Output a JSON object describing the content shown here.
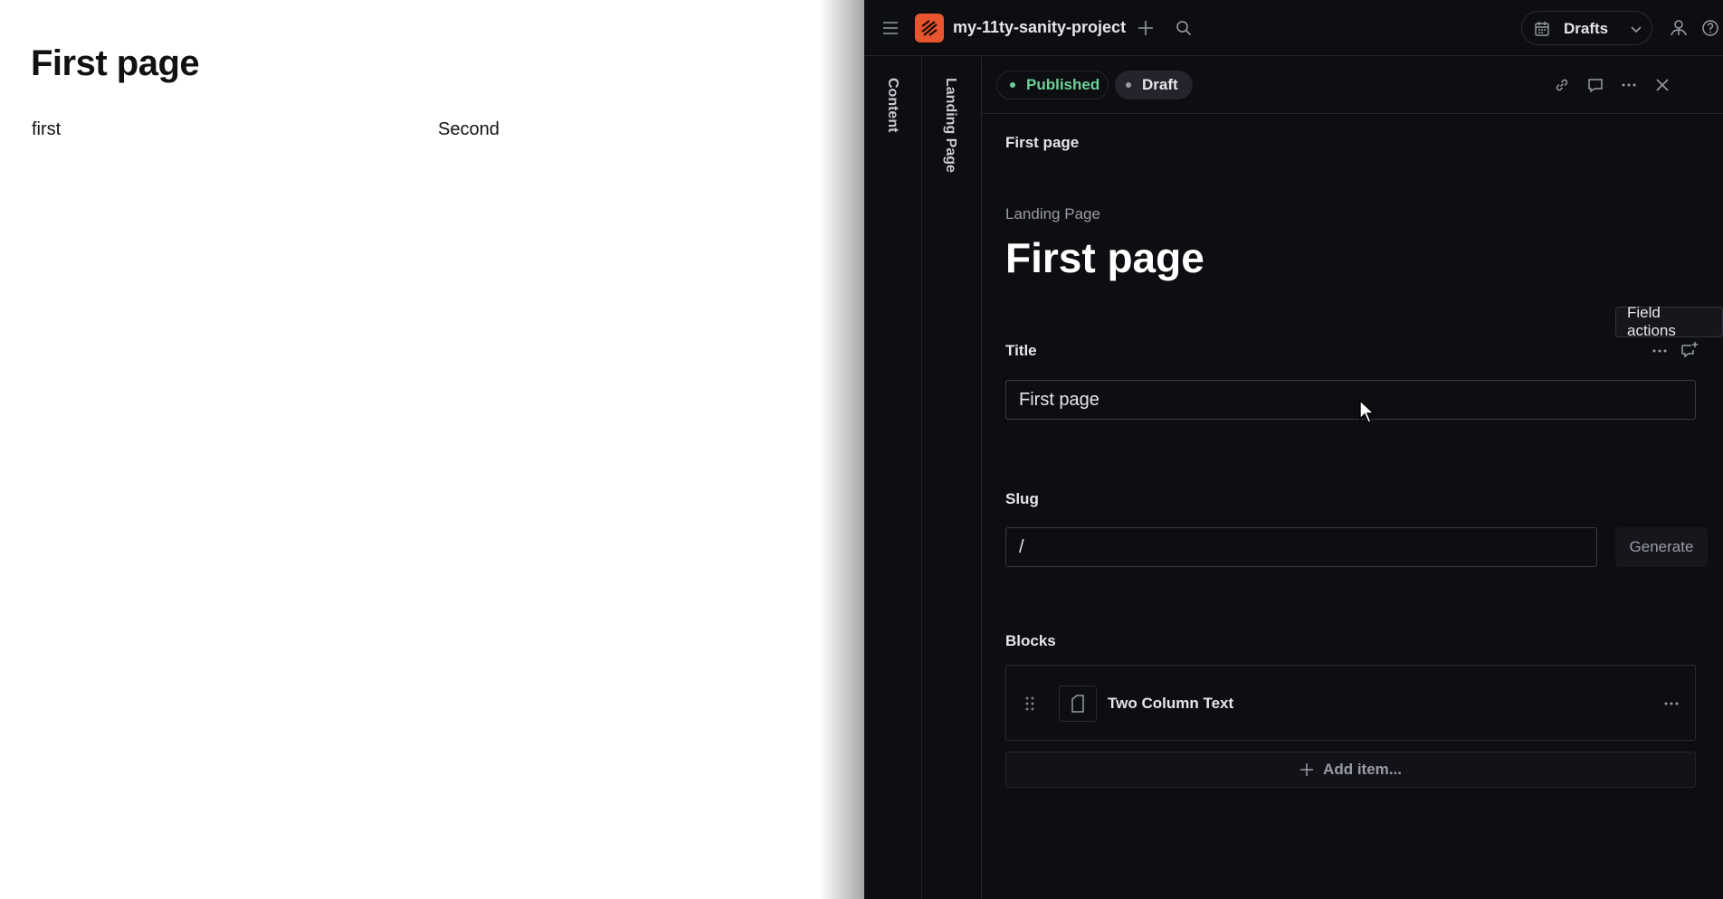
{
  "preview": {
    "title": "First page",
    "column_left": "first",
    "column_right": "Second"
  },
  "topbar": {
    "project_name": "my-11ty-sanity-project",
    "perspective": "Drafts",
    "logo_color": "#e8552e"
  },
  "sidebar": {
    "content_label": "Content",
    "landing_label": "Landing Page"
  },
  "document": {
    "status_published": "Published",
    "status_draft": "Draft",
    "published_color": "#6fcf97",
    "breadcrumb": "First page",
    "type_label": "Landing Page",
    "heading": "First page",
    "tooltip": "Field actions",
    "fields": {
      "title_label": "Title",
      "title_value": "First page",
      "slug_label": "Slug",
      "slug_value": "/",
      "generate_label": "Generate",
      "blocks_label": "Blocks",
      "block_item_name": "Two Column Text",
      "add_item_label": "Add item..."
    }
  }
}
